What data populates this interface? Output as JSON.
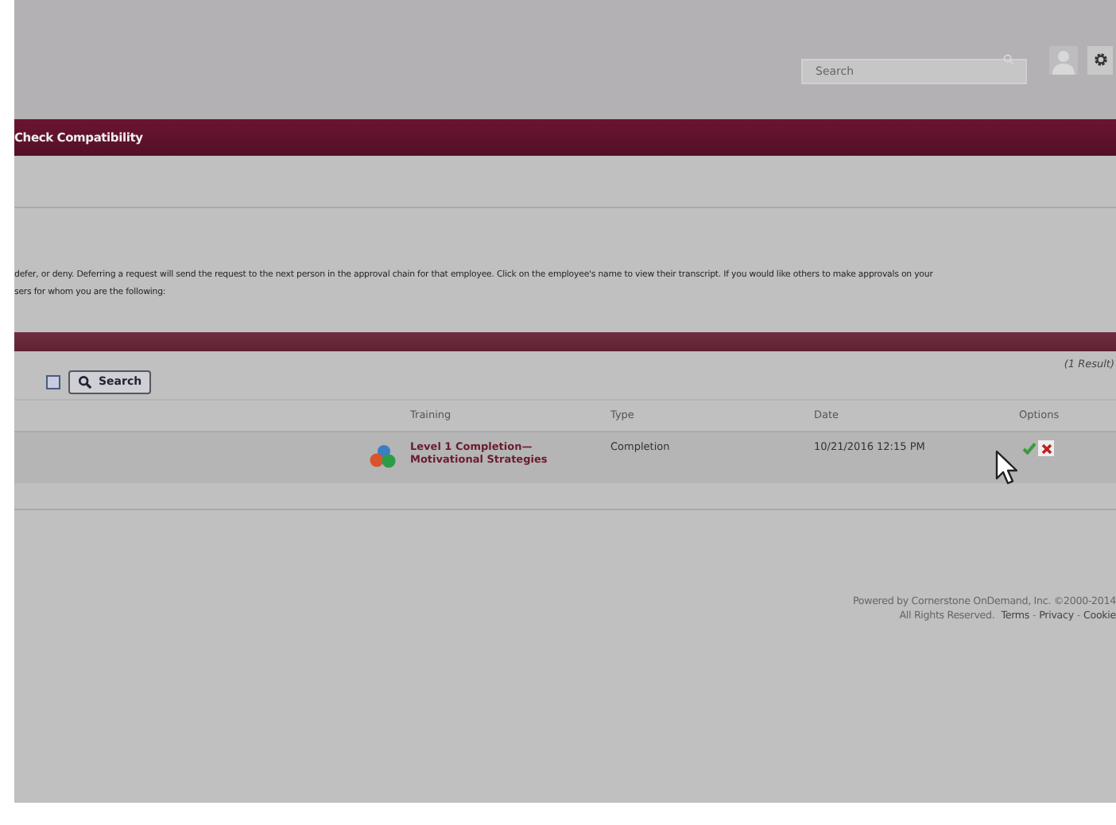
{
  "header": {
    "search": {
      "placeholder": "Search"
    }
  },
  "banner": {
    "title": "Check Compatibility"
  },
  "instructions": [
    "defer, or deny. Deferring a request will send the request to the next person in the approval chain for that employee. Click on the employee's name to view their transcript. If you would like others to make approvals on your",
    "sers for whom you are the following:"
  ],
  "filter": {
    "checked": false,
    "search_button": "Search",
    "result_count": "(1 Result)"
  },
  "table": {
    "columns": [
      "Training",
      "Type",
      "Date",
      "Options"
    ],
    "rows": [
      {
        "training": "Level 1 Completion—Motivational Strategies",
        "type": "Completion",
        "date": "10/21/2016 12:15 PM"
      }
    ]
  },
  "footer": {
    "powered_by": "Powered by Cornerstone OnDemand, Inc. ©2000-2014",
    "rights": "All Rights Reserved.",
    "links": [
      "Terms",
      "Privacy",
      "Cookie"
    ],
    "separator": "-"
  }
}
